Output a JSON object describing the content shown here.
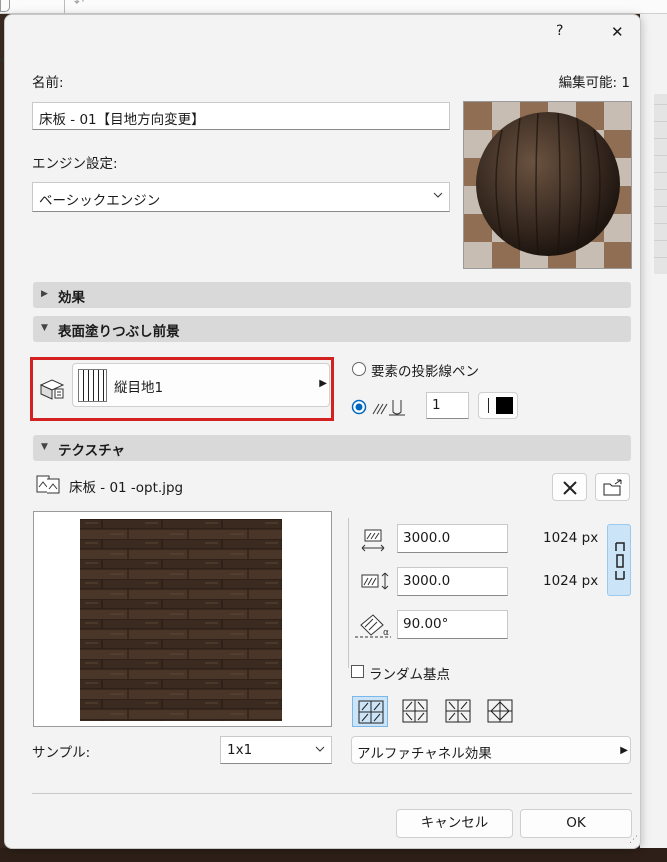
{
  "title_bar": {
    "help": "?",
    "close": "✕"
  },
  "name": {
    "label": "名前:",
    "value": "床板 - 01【目地方向変更】",
    "editable": "編集可能: 1"
  },
  "engine": {
    "label": "エンジン設定:",
    "value": "ベーシックエンジン"
  },
  "sections": {
    "effects": "効果",
    "surface": "表面塗りつぶし前景",
    "texture": "テクスチャ"
  },
  "surface": {
    "fill_name": "縦目地1",
    "radio_element_pen": "要素の投影線ペン",
    "pen_number": "1",
    "highlight_color": "#d32020"
  },
  "texture": {
    "file_name": "床板 - 01 -opt.jpg",
    "width": "3000.0",
    "height": "3000.0",
    "angle": "90.00°",
    "px_width": "1024 px",
    "px_height": "1024 px",
    "random_origin": "ランダム基点",
    "sample_label": "サンプル:",
    "sample_value": "1x1",
    "alpha_channel": "アルファチャネル効果"
  },
  "buttons": {
    "cancel": "キャンセル",
    "ok": "OK"
  },
  "colors": {
    "accent": "#0067c0",
    "wood_dark": "#3e2c20",
    "section_bg": "#d9d9d9"
  }
}
